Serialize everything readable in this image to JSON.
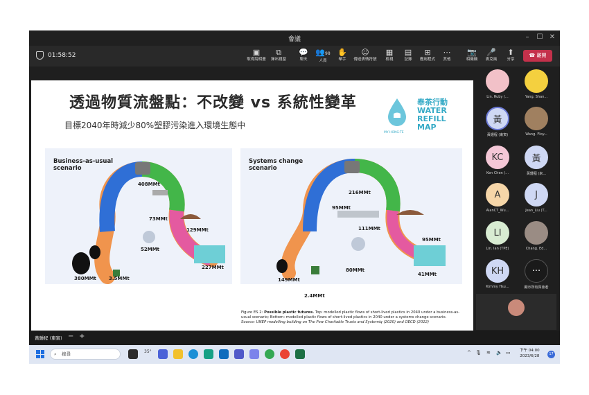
{
  "window": {
    "title": "會議"
  },
  "toolbar": {
    "timer": "01:58:52",
    "buttons": [
      {
        "label": "取得說明畫",
        "icon": "▣"
      },
      {
        "label": "彈出視窗",
        "icon": "⧉"
      },
      {
        "label": "聊天",
        "icon": "💬"
      },
      {
        "label": "人員",
        "icon": "👥",
        "badge": "98"
      },
      {
        "label": "舉手",
        "icon": "✋"
      },
      {
        "label": "傳送表情符號",
        "icon": "☺"
      },
      {
        "label": "檢視",
        "icon": "▦"
      },
      {
        "label": "記錄",
        "icon": "▤"
      },
      {
        "label": "應用程式",
        "icon": "⊞"
      },
      {
        "label": "其他",
        "icon": "⋯"
      },
      {
        "label": "相機機",
        "icon": "📷"
      },
      {
        "label": "麥克風",
        "icon": "🎤"
      },
      {
        "label": "分享",
        "icon": "⬆"
      }
    ],
    "leave_label": "離開"
  },
  "slide": {
    "title": "透過物質流盤點：不改變 vs 系統性變革",
    "subtitle": "目標2040年時減少80%塑膠污染進入環境生態中",
    "logo": {
      "line1": "奉茶行動",
      "line2": "WATER",
      "line3": "REFILL",
      "line4": "MAP",
      "small": "MY HONG-TE"
    },
    "panel_left": {
      "title": "Business-as-usual\nscenario",
      "values": [
        "408MMt",
        "73MMt",
        "129MMt",
        "52MMt",
        "227MMt",
        "380MMt",
        "3.5MMt"
      ]
    },
    "panel_right": {
      "title": "Systems change\nscenario",
      "values": [
        "216MMt",
        "95MMt",
        "111MMt",
        "95MMt",
        "80MMt",
        "41MMt",
        "149MMt",
        "2.4MMt"
      ]
    },
    "caption": {
      "label": "Figure ES 2:",
      "bold": "Possible plastic futures.",
      "text": "Top: modelled plastic flows of short-lived plastics in 2040 under a business-as-usual scenario; Bottom: modelled plastic flows of short-lived plastics in 2040 under a systems change scenario.",
      "source": "Source: UNEP modelling building on The Pew Charitable Trusts and Systemiq (2020) and OECD (2022)"
    }
  },
  "participants": [
    {
      "name": "Lin. Ruby (...",
      "initials": "",
      "color": "#f2c1c8"
    },
    {
      "name": "Yang. Shan...",
      "initials": "",
      "color": "#f4d03f"
    },
    {
      "name": "黃鍾程 (東寅)",
      "initials": "黃",
      "color": "#cfd8f4"
    },
    {
      "name": "Wang. Floy...",
      "initials": "",
      "color": "#a08060"
    },
    {
      "name": "Ken Chen (...",
      "initials": "KC",
      "color": "#f4c7d6"
    },
    {
      "name": "黃鍾程 (來...",
      "initials": "黃",
      "color": "#cfd8f4"
    },
    {
      "name": "AlanCT_Wu...",
      "initials": "A",
      "color": "#f6d6a8"
    },
    {
      "name": "Jean_Liu (T...",
      "initials": "J",
      "color": "#cfd8f4"
    },
    {
      "name": "Lin. Ian (TPE)",
      "initials": "LI",
      "color": "#d8ecd2"
    },
    {
      "name": "Chang. Ed...",
      "initials": "",
      "color": "#9a8c84"
    },
    {
      "name": "Kimmy Hsu...",
      "initials": "KH",
      "color": "#cfd8f4"
    },
    {
      "name": "顯示所有與會者",
      "initials": "···",
      "color": "#1a1a1a"
    }
  ],
  "bottom": {
    "speaker": "黃鍾程 (東寅)",
    "minus": "−",
    "plus": "+"
  },
  "taskbar": {
    "search_placeholder": "搜尋",
    "weather": "35°",
    "clock_time": "下午 04:00",
    "clock_date": "2023/6/28",
    "notif": "17"
  }
}
